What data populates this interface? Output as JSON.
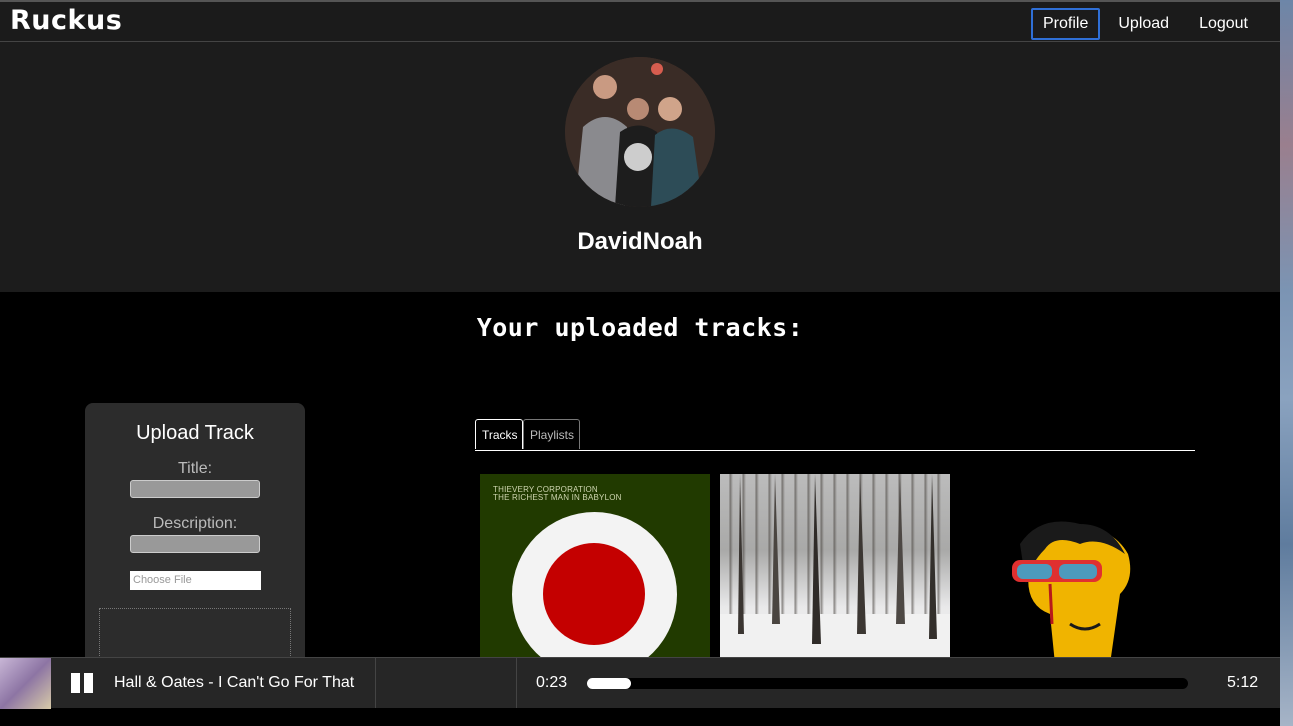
{
  "app": {
    "name": "Ruckus"
  },
  "nav": {
    "profile": "Profile",
    "upload": "Upload",
    "logout": "Logout"
  },
  "profile": {
    "username": "DavidNoah"
  },
  "main": {
    "section_title": "Your uploaded tracks:"
  },
  "upload_form": {
    "heading": "Upload Track",
    "title_label": "Title:",
    "title_value": "",
    "description_label": "Description:",
    "description_value": "",
    "file_button": "Choose File"
  },
  "tabs": [
    {
      "label": "Tracks",
      "active": true
    },
    {
      "label": "Playlists",
      "active": false
    }
  ],
  "tracks": [
    {
      "cover_line1": "THIEVERY CORPORATION",
      "cover_line2": "THE RICHEST MAN IN BABYLON"
    },
    {
      "cover_line1": "",
      "cover_line2": ""
    },
    {
      "cover_line1": "",
      "cover_line2": ""
    }
  ],
  "player": {
    "now_playing": "Hall & Oates - I Can't Go For That",
    "elapsed": "0:23",
    "duration": "5:12",
    "progress": 0.074,
    "state": "playing"
  },
  "colors": {
    "accent": "#2f6fd6",
    "bar_bg": "#1b1b1b",
    "player_bg": "#262626"
  }
}
